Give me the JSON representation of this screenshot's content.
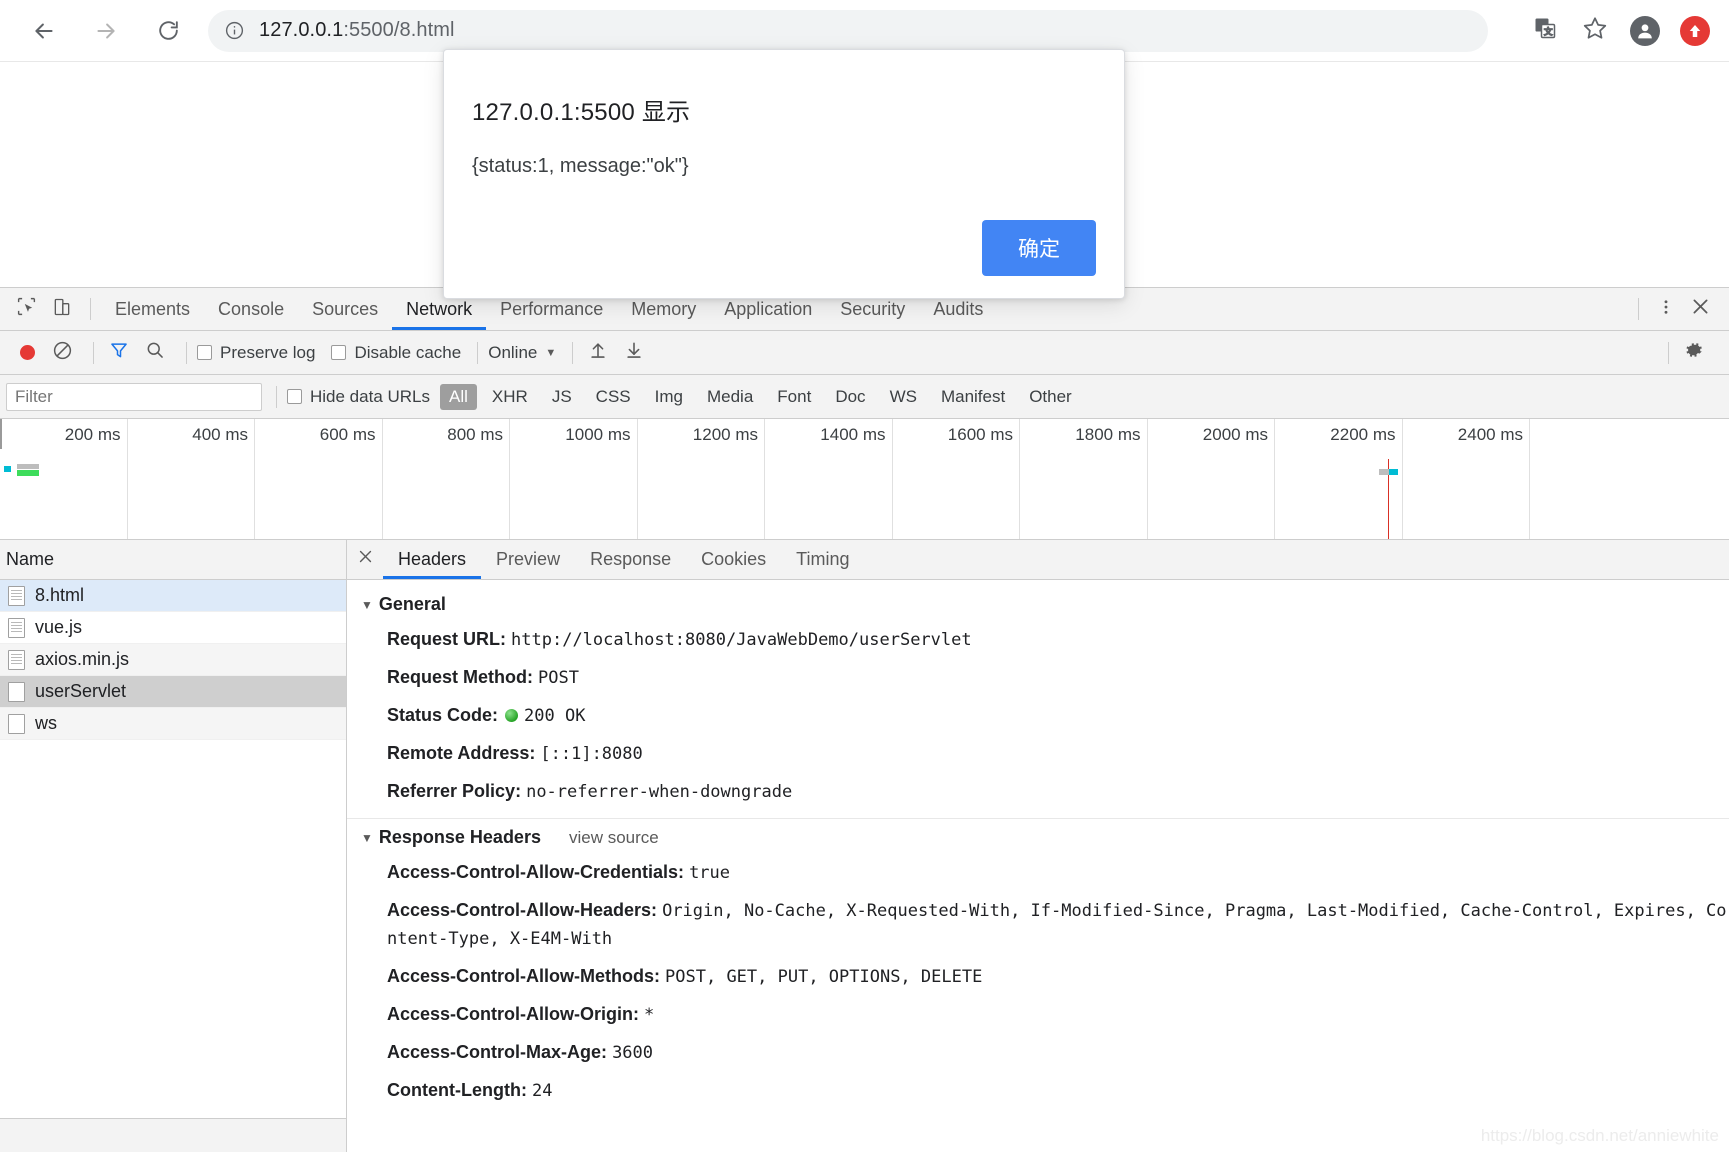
{
  "browser": {
    "url_main": "127.0.0.1",
    "url_rest": ":5500/8.html",
    "back_icon": "arrow-left-icon",
    "forward_icon": "arrow-right-icon",
    "reload_icon": "reload-icon",
    "info_icon": "info-circle-icon",
    "translate_icon": "translate-icon",
    "bookmark_icon": "star-icon",
    "profile_icon": "account-icon",
    "update_icon": "update-arrow-icon"
  },
  "dialog": {
    "title": "127.0.0.1:5500 显示",
    "message": "{status:1, message:\"ok\"}",
    "ok_label": "确定",
    "accent": "#4285f4"
  },
  "devtools": {
    "tabs": [
      {
        "label": "Elements",
        "active": false
      },
      {
        "label": "Console",
        "active": false
      },
      {
        "label": "Sources",
        "active": false
      },
      {
        "label": "Network",
        "active": true
      },
      {
        "label": "Performance",
        "active": false
      },
      {
        "label": "Memory",
        "active": false
      },
      {
        "label": "Application",
        "active": false
      },
      {
        "label": "Security",
        "active": false
      },
      {
        "label": "Audits",
        "active": false
      }
    ],
    "inspect_icon": "inspect-cursor-icon",
    "device_icon": "device-toolbar-icon",
    "more_icon": "kebab-menu-icon",
    "close_icon": "close-icon",
    "accent": "#1a73e8"
  },
  "network_toolbar": {
    "record_icon": "record-dot-icon",
    "clear_icon": "clear-no-entry-icon",
    "filter_icon": "funnel-icon",
    "search_icon": "magnifier-icon",
    "preserve_log_label": "Preserve log",
    "preserve_log_checked": false,
    "disable_cache_label": "Disable cache",
    "disable_cache_checked": false,
    "throttle_value": "Online",
    "import_icon": "upload-arrow-icon",
    "export_icon": "download-arrow-icon",
    "settings_icon": "gear-icon"
  },
  "filter_bar": {
    "filter_placeholder": "Filter",
    "filter_value": "",
    "hide_data_urls_label": "Hide data URLs",
    "hide_data_urls_checked": false,
    "types": [
      {
        "label": "All",
        "active": true
      },
      {
        "label": "XHR",
        "active": false
      },
      {
        "label": "JS",
        "active": false
      },
      {
        "label": "CSS",
        "active": false
      },
      {
        "label": "Img",
        "active": false
      },
      {
        "label": "Media",
        "active": false
      },
      {
        "label": "Font",
        "active": false
      },
      {
        "label": "Doc",
        "active": false
      },
      {
        "label": "WS",
        "active": false
      },
      {
        "label": "Manifest",
        "active": false
      },
      {
        "label": "Other",
        "active": false
      }
    ]
  },
  "overview": {
    "ticks": [
      "200 ms",
      "400 ms",
      "600 ms",
      "800 ms",
      "1000 ms",
      "1200 ms",
      "1400 ms",
      "1600 ms",
      "1800 ms",
      "2000 ms",
      "2200 ms",
      "2400 ms"
    ]
  },
  "requests": {
    "column_header": "Name",
    "rows": [
      {
        "name": "8.html",
        "state": "selected",
        "icon": "document-icon"
      },
      {
        "name": "vue.js",
        "state": "normal",
        "icon": "document-icon"
      },
      {
        "name": "axios.min.js",
        "state": "odd",
        "icon": "document-icon"
      },
      {
        "name": "userServlet",
        "state": "hovered",
        "icon": "blank-document-icon"
      },
      {
        "name": "ws",
        "state": "odd",
        "icon": "blank-document-icon"
      }
    ]
  },
  "details": {
    "close_icon": "close-icon",
    "tabs": [
      {
        "label": "Headers",
        "active": true
      },
      {
        "label": "Preview",
        "active": false
      },
      {
        "label": "Response",
        "active": false
      },
      {
        "label": "Cookies",
        "active": false
      },
      {
        "label": "Timing",
        "active": false
      }
    ],
    "general": {
      "title": "General",
      "rows": [
        {
          "name": "Request URL:",
          "value": "http://localhost:8080/JavaWebDemo/userServlet"
        },
        {
          "name": "Request Method:",
          "value": "POST"
        },
        {
          "name": "Status Code:",
          "value": "200 OK",
          "status_dot": true
        },
        {
          "name": "Remote Address:",
          "value": "[::1]:8080"
        },
        {
          "name": "Referrer Policy:",
          "value": "no-referrer-when-downgrade"
        }
      ]
    },
    "response_headers": {
      "title": "Response Headers",
      "view_source": "view source",
      "rows": [
        {
          "name": "Access-Control-Allow-Credentials:",
          "value": "true"
        },
        {
          "name": "Access-Control-Allow-Headers:",
          "value": "Origin, No-Cache, X-Requested-With, If-Modified-Since, Pragma, Last-Modified, Cache-Control, Expires, Content-Type, X-E4M-With"
        },
        {
          "name": "Access-Control-Allow-Methods:",
          "value": "POST, GET, PUT, OPTIONS, DELETE"
        },
        {
          "name": "Access-Control-Allow-Origin:",
          "value": "*"
        },
        {
          "name": "Access-Control-Max-Age:",
          "value": "3600"
        },
        {
          "name": "Content-Length:",
          "value": "24"
        }
      ]
    }
  },
  "watermark": "https://blog.csdn.net/anniewhite"
}
